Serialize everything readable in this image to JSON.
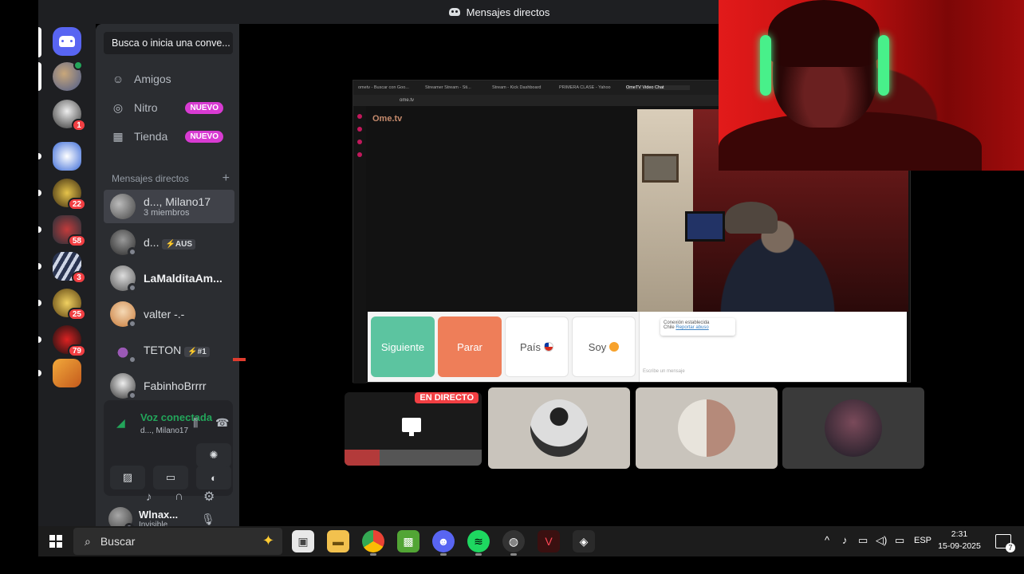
{
  "window": {
    "title": "Mensajes directos"
  },
  "rail": {
    "servers": [
      {
        "name": "home",
        "badge": ""
      },
      {
        "name": "server-1",
        "badge": ""
      },
      {
        "name": "server-2",
        "badge": "1"
      },
      {
        "name": "server-3",
        "badge": ""
      },
      {
        "name": "server-4",
        "badge": "22"
      },
      {
        "name": "server-5",
        "badge": "58"
      },
      {
        "name": "server-6",
        "badge": "3"
      },
      {
        "name": "server-7",
        "badge": "25"
      },
      {
        "name": "server-8",
        "badge": "79"
      },
      {
        "name": "server-9",
        "badge": ""
      }
    ]
  },
  "sidebar": {
    "search_placeholder": "Busca o inicia una conve...",
    "nav": [
      {
        "label": "Amigos",
        "badge": ""
      },
      {
        "label": "Nitro",
        "badge": "NUEVO"
      },
      {
        "label": "Tienda",
        "badge": "NUEVO"
      }
    ],
    "dm_header": "Mensajes directos",
    "dm_add": "+",
    "dms": [
      {
        "name": "d..., Milano17",
        "sub": "3 miembros",
        "tag": ""
      },
      {
        "name": "d...",
        "sub": "",
        "tag": "⚡AUS"
      },
      {
        "name": "LaMalditaAm...",
        "sub": "",
        "tag": ""
      },
      {
        "name": "valter -.-",
        "sub": "",
        "tag": ""
      },
      {
        "name": "TETON",
        "sub": "",
        "tag": "⚡#1"
      },
      {
        "name": "FabinhoBrrrr",
        "sub": "",
        "tag": ""
      }
    ]
  },
  "voice": {
    "status": "Voz conectada",
    "channel": "d..., Milano17"
  },
  "user": {
    "name": "Wlnax...",
    "status": "Invisible"
  },
  "shared_screen": {
    "tabs": [
      "ometv - Buscar con Goo...",
      "Streamer Stream - Sti...",
      "Stream - Kick Dashboard",
      "PRIMERA CLASE - Yahoo",
      "OmeTV Video Chat"
    ],
    "address": "ome.tv",
    "logo": "Ome.tv",
    "buttons": {
      "next": "Siguiente",
      "stop": "Parar",
      "country": "País",
      "gender": "Soy"
    },
    "chat": {
      "status": "Conexión establecida",
      "country": "Chile",
      "report": "Reportar abuso",
      "input_placeholder": "Escribe un mensaje"
    }
  },
  "stream_tiles": {
    "live_label": "EN DIRECTO"
  },
  "taskbar": {
    "search": "Buscar",
    "lang": "ESP",
    "time": "2:31",
    "date": "15-09-2025",
    "notifications": "7"
  },
  "colors": {
    "discord_blurple": "#5865f2",
    "nuevo_badge": "#d83bd2",
    "voice_green": "#23a55a",
    "badge_red": "#f23f43",
    "btn_next": "#5cc4a0",
    "btn_stop": "#ee7e59"
  }
}
